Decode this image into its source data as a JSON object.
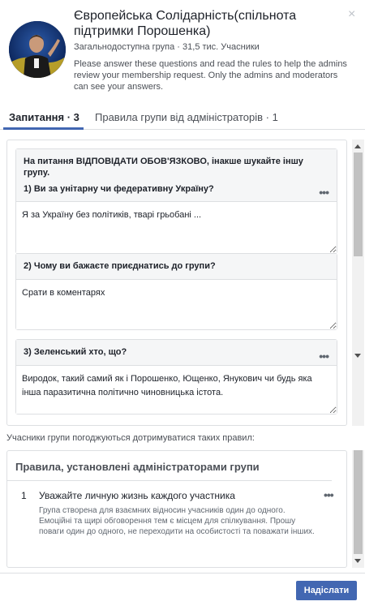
{
  "group": {
    "title": "Європейська Солідарність(спільнота підтримки Порошенка)",
    "privacy": "Загальнодоступна група",
    "separator": "·",
    "members": "31,5 тис. Учасники",
    "intro": "Please answer these questions and read the rules to help the admins review your membership request. Only the admins and moderators can see your answers."
  },
  "tabs": [
    {
      "label": "Запитання · 3",
      "active": true
    },
    {
      "label": "Правила групи від адміністраторів · 1",
      "active": false
    }
  ],
  "questions": [
    {
      "prompt": "На питання ВІДПОВІДАТИ ОБОВ'ЯЗКОВО, інакше шукайте іншу групу.",
      "question": "1) Ви за унітарну чи федеративну Україну?",
      "answer": "Я за Україну без політиків, тварі грьобані ..."
    },
    {
      "question": "2) Чому ви бажаєте приєднатись до групи?",
      "answer": "Срати в коментарях"
    },
    {
      "question": "3) Зеленський хто, що?",
      "answer": "Виродок, такий самий як і Порошенко, Ющенко, Янукович чи будь яка інша паразитична політично чиновницька істота."
    }
  ],
  "agreement_text": "Учасники групи погоджуються дотримуватися таких правил:",
  "rules_panel": {
    "title": "Правила, установлені адміністраторами групи",
    "rules": [
      {
        "number": "1",
        "title": "Уважайте личную жизнь каждого участника",
        "description": "Група створена для взаємних відносин учасників один до одного. Емоційні та щирі обговорення тем є місцем для спілкування. Прошу поваги один до одного, не переходити на особистості та поважати інших."
      }
    ]
  },
  "submit_label": "Надіслати",
  "icons": {
    "close": "close-icon",
    "more": "more-options-icon"
  },
  "colors": {
    "accent": "#4267b2",
    "text": "#1d2129",
    "muted": "#4b4f56"
  }
}
